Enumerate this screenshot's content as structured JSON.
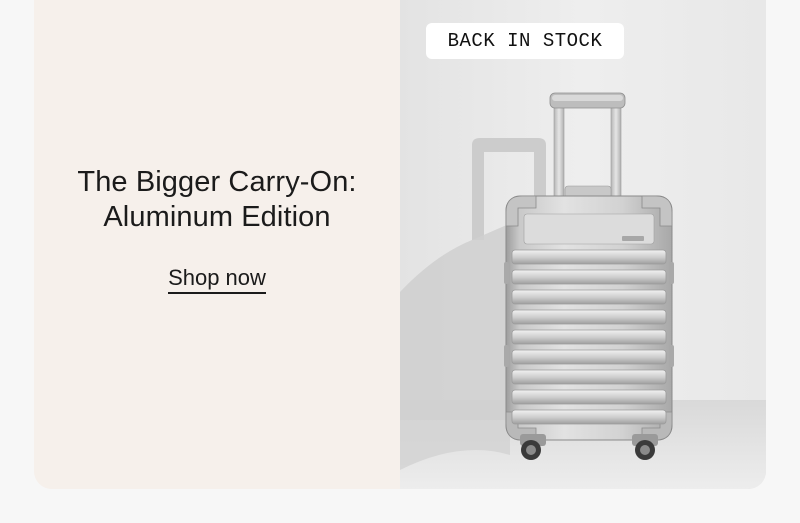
{
  "promo": {
    "headline_line1": "The Bigger Carry-On:",
    "headline_line2": "Aluminum Edition",
    "cta_label": "Shop now",
    "badge_label": "BACK IN STOCK"
  },
  "colors": {
    "left_panel": "#f6f0eb",
    "right_panel": "#ececec",
    "text": "#1b1b1b",
    "badge_bg": "#ffffff"
  },
  "icons": [
    "aluminum-suitcase-image"
  ]
}
